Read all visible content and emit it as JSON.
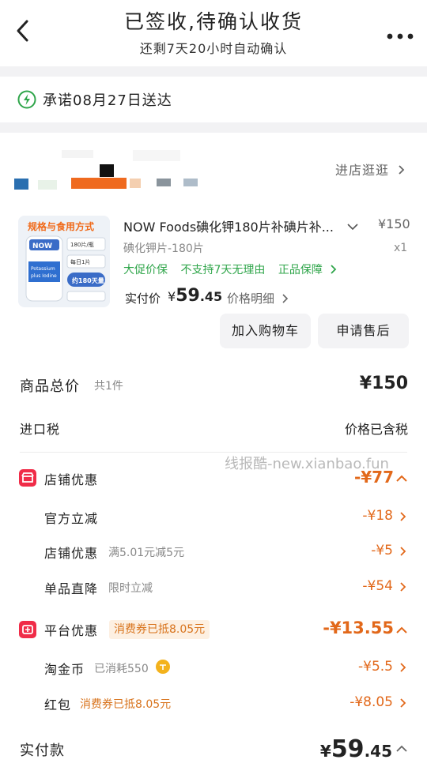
{
  "header": {
    "title": "已签收,待确认收货",
    "subtitle": "还剩7天20小时自动确认"
  },
  "promise": {
    "text": "承诺08月27日送达"
  },
  "store": {
    "enter_label": "进店逛逛"
  },
  "product": {
    "name": "NOW Foods碘化钾180片补碘片补...",
    "price": "¥150",
    "spec": "碘化钾片-180片",
    "qty": "x1",
    "guarantees": [
      "大促价保",
      "不支持7天无理由",
      "正品保障"
    ],
    "actual_label": "实付价",
    "actual_price": {
      "symbol": "¥",
      "int": "59",
      "dec": ".45"
    },
    "price_detail_label": "价格明细",
    "image_texts": {
      "banner": "规格与食用方式",
      "brand": "NOW",
      "bottle_line1": "Potassium",
      "bottle_line2": "plus Iodine",
      "spec_line1": "180片/瓶",
      "spec_line2": "每日1片",
      "badge": "约180天量"
    }
  },
  "buttons": {
    "add_cart": "加入购物车",
    "after_sale": "申请售后"
  },
  "totals": {
    "goods_total_label": "商品总价",
    "goods_total_sub": "共1件",
    "goods_total_value": "¥150",
    "tax_label": "进口税",
    "tax_value": "价格已含税"
  },
  "watermark": "线报酷-new.xianbao.fun",
  "shop_discount": {
    "label": "店铺优惠",
    "value": "-¥77",
    "items": [
      {
        "label": "官方立减",
        "sub": "",
        "value": "-¥18"
      },
      {
        "label": "店铺优惠",
        "sub": "满5.01元减5元",
        "value": "-¥5"
      },
      {
        "label": "单品直降",
        "sub": "限时立减",
        "value": "-¥54"
      }
    ]
  },
  "platform_discount": {
    "label": "平台优惠",
    "tag": "消费券已抵8.05元",
    "value": "-¥13.55",
    "items": [
      {
        "label": "淘金币",
        "sub": "已消耗550",
        "value": "-¥5.5"
      },
      {
        "label": "红包",
        "sub": "消费券已抵8.05元",
        "value": "-¥8.05"
      }
    ]
  },
  "payment": {
    "label": "实付款",
    "symbol": "¥",
    "int": "59",
    "dec": ".45"
  },
  "colors": {
    "accent_orange": "#e2681a",
    "guarantee_green": "#2fa54a",
    "discount_red": "#f02c48"
  },
  "icons": [
    "back-arrow-icon",
    "more-icon",
    "lightning-icon",
    "chevron-right-icon",
    "chevron-down-icon",
    "chevron-up-icon",
    "shop-icon",
    "platform-icon",
    "coin-icon"
  ]
}
